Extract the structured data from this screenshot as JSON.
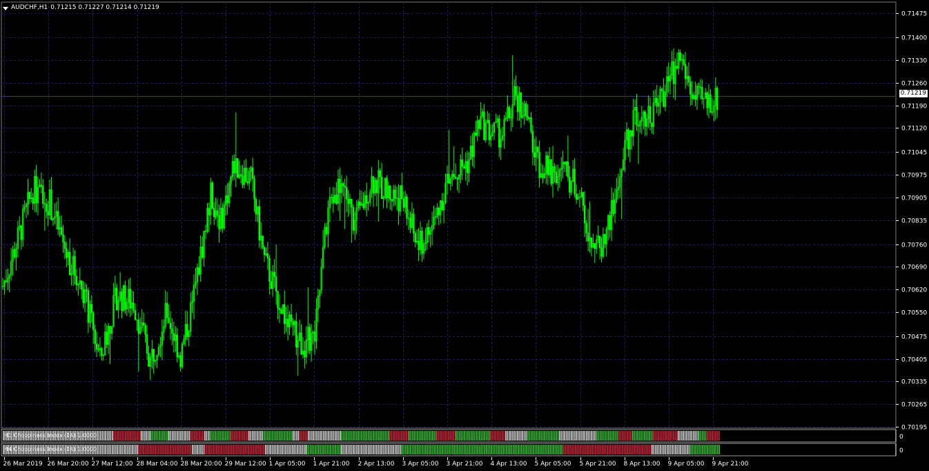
{
  "header": {
    "symbol": "AUDCHF,H1",
    "ohlc": "0.71215 0.71227 0.71214 0.71219"
  },
  "current_price_label": "0.71219",
  "indicators": [
    {
      "label": "H1 Choppiness Index (14) 1.0000"
    },
    {
      "label": "H4 Choppiness Index (14) 1.0000"
    }
  ],
  "price_axis": {
    "ticks": [
      "0.71475",
      "0.71400",
      "0.71330",
      "0.71260",
      "0.71190",
      "0.71120",
      "0.71045",
      "0.70975",
      "0.70905",
      "0.70835",
      "0.70760",
      "0.70690",
      "0.70620",
      "0.70550",
      "0.70475",
      "0.70405",
      "0.70335",
      "0.70265",
      "0.70195"
    ],
    "ylim": [
      0.7019,
      0.7151
    ]
  },
  "time_axis": {
    "ticks": [
      "26 Mar 2019",
      "26 Mar 20:00",
      "27 Mar 12:00",
      "28 Mar 04:00",
      "28 Mar 20:00",
      "29 Mar 12:00",
      "1 Apr 05:00",
      "1 Apr 21:00",
      "2 Apr 13:00",
      "3 Apr 05:00",
      "3 Apr 21:00",
      "4 Apr 13:00",
      "5 Apr 05:00",
      "5 Apr 21:00",
      "8 Apr 13:00",
      "9 Apr 05:00",
      "9 Apr 21:00"
    ]
  },
  "colors": {
    "background": "#000000",
    "grid": "#1f1f6b",
    "candle": "#00ff00",
    "indicator_red": "#c1243a",
    "indicator_green": "#34b534",
    "indicator_gray": "#c8c8c8",
    "axis_text": "#ffffff"
  },
  "chart_data": {
    "type": "candlestick",
    "timeframe": "H1",
    "symbol": "AUDCHF",
    "ylim": [
      0.7019,
      0.7151
    ],
    "close_path": [
      [
        0,
        0.7063
      ],
      [
        8,
        0.7076
      ],
      [
        18,
        0.7093
      ],
      [
        28,
        0.7089
      ],
      [
        38,
        0.7073
      ],
      [
        48,
        0.7062
      ],
      [
        58,
        0.704
      ],
      [
        68,
        0.706
      ],
      [
        78,
        0.7058
      ],
      [
        88,
        0.704
      ],
      [
        98,
        0.7055
      ],
      [
        106,
        0.7041
      ],
      [
        114,
        0.706
      ],
      [
        124,
        0.7091
      ],
      [
        130,
        0.7083
      ],
      [
        138,
        0.7101
      ],
      [
        148,
        0.7096
      ],
      [
        156,
        0.7071
      ],
      [
        164,
        0.706
      ],
      [
        170,
        0.7051
      ],
      [
        178,
        0.7045
      ],
      [
        186,
        0.7047
      ],
      [
        194,
        0.7087
      ],
      [
        202,
        0.7096
      ],
      [
        210,
        0.7082
      ],
      [
        220,
        0.7096
      ],
      [
        230,
        0.7092
      ],
      [
        238,
        0.709
      ],
      [
        248,
        0.7075
      ],
      [
        256,
        0.7081
      ],
      [
        264,
        0.7094
      ],
      [
        272,
        0.7099
      ],
      [
        278,
        0.7102
      ],
      [
        284,
        0.7114
      ],
      [
        290,
        0.7111
      ],
      [
        298,
        0.711
      ],
      [
        306,
        0.7122
      ],
      [
        312,
        0.7116
      ],
      [
        318,
        0.7102
      ],
      [
        326,
        0.7098
      ],
      [
        334,
        0.7099
      ],
      [
        342,
        0.7094
      ],
      [
        350,
        0.7079
      ],
      [
        356,
        0.7074
      ],
      [
        364,
        0.7087
      ],
      [
        372,
        0.7108
      ],
      [
        378,
        0.7117
      ],
      [
        386,
        0.7116
      ],
      [
        394,
        0.7123
      ],
      [
        404,
        0.7134
      ],
      [
        412,
        0.7121
      ],
      [
        418,
        0.712
      ],
      [
        426,
        0.7121
      ]
    ],
    "indicator_rows": [
      {
        "name": "H1 Choppiness Index (14)",
        "value": "1.0000",
        "segments": [
          [
            0,
            160,
            "gray"
          ],
          [
            160,
            200,
            "red"
          ],
          [
            200,
            214,
            "gray"
          ],
          [
            214,
            240,
            "green"
          ],
          [
            240,
            272,
            "gray"
          ],
          [
            272,
            292,
            "red"
          ],
          [
            292,
            300,
            "gray"
          ],
          [
            300,
            330,
            "green"
          ],
          [
            330,
            356,
            "red"
          ],
          [
            356,
            378,
            "gray"
          ],
          [
            378,
            420,
            "green"
          ],
          [
            420,
            430,
            "gray"
          ],
          [
            430,
            442,
            "red"
          ],
          [
            442,
            490,
            "gray"
          ],
          [
            490,
            560,
            "green"
          ],
          [
            560,
            588,
            "red"
          ],
          [
            588,
            628,
            "green"
          ],
          [
            628,
            656,
            "red"
          ],
          [
            656,
            706,
            "green"
          ],
          [
            706,
            728,
            "red"
          ],
          [
            728,
            760,
            "gray"
          ],
          [
            760,
            806,
            "green"
          ],
          [
            806,
            860,
            "gray"
          ],
          [
            860,
            892,
            "green"
          ],
          [
            892,
            912,
            "red"
          ],
          [
            912,
            942,
            "green"
          ],
          [
            942,
            978,
            "red"
          ],
          [
            978,
            1008,
            "gray"
          ],
          [
            1008,
            1020,
            "green"
          ],
          [
            1020,
            1038,
            "red"
          ]
        ]
      },
      {
        "name": "H4 Choppiness Index (14)",
        "value": "1.0000",
        "segments": [
          [
            0,
            196,
            "gray"
          ],
          [
            196,
            274,
            "red"
          ],
          [
            274,
            292,
            "gray"
          ],
          [
            292,
            380,
            "red"
          ],
          [
            380,
            440,
            "gray"
          ],
          [
            440,
            490,
            "green"
          ],
          [
            490,
            578,
            "gray"
          ],
          [
            578,
            700,
            "green"
          ],
          [
            700,
            812,
            "green"
          ],
          [
            812,
            940,
            "red"
          ],
          [
            940,
            996,
            "gray"
          ],
          [
            996,
            1038,
            "green"
          ]
        ]
      }
    ]
  }
}
